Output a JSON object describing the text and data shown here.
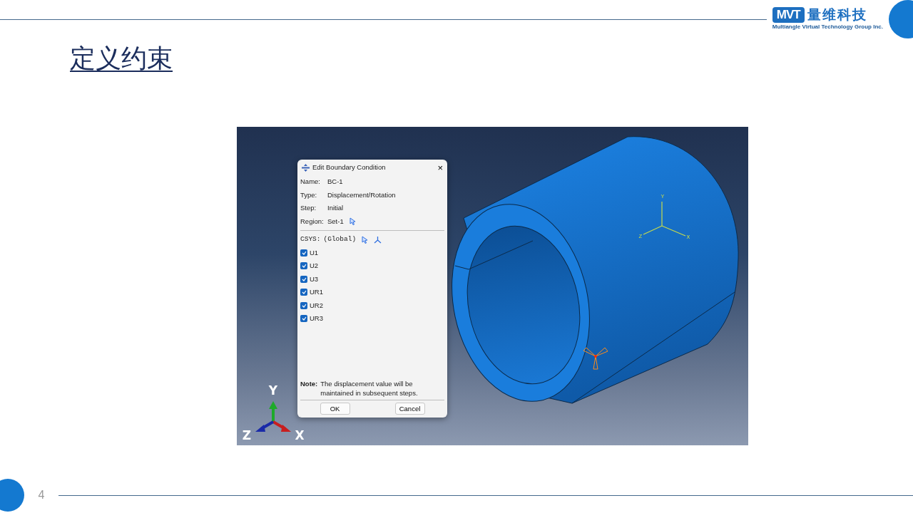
{
  "header": {
    "logo_mark": "MVT",
    "logo_name": "量维科技",
    "logo_tagline": "Multiangle Virtual Technology Group Inc."
  },
  "title": "定义约束",
  "viewport": {
    "dialog": {
      "title": "Edit Boundary Condition",
      "close": "×",
      "fields": [
        {
          "label": "Name:",
          "value": "BC-1",
          "kind": "text"
        },
        {
          "label": "Type:",
          "value": "Displacement/Rotation",
          "kind": "text"
        },
        {
          "label": "Step:",
          "value": "Initial",
          "kind": "text"
        },
        {
          "label": "Region:",
          "value": "Set-1",
          "kind": "picker"
        }
      ],
      "csys": {
        "label": "CSYS:",
        "value": "(Global)"
      },
      "dofs": [
        {
          "label": "U1",
          "checked": true
        },
        {
          "label": "U2",
          "checked": true
        },
        {
          "label": "U3",
          "checked": true
        },
        {
          "label": "UR1",
          "checked": true
        },
        {
          "label": "UR2",
          "checked": true
        },
        {
          "label": "UR3",
          "checked": true
        }
      ],
      "note": {
        "label": "Note:",
        "text": "The displacement value will be maintained in subsequent steps."
      },
      "buttons": [
        "OK",
        "Cancel"
      ]
    },
    "model_triad": {
      "y": "Y",
      "z": "Z",
      "x": "X"
    },
    "view_triad": {
      "y": "Y",
      "z": "Z",
      "x": "X"
    }
  },
  "page_number": "4"
}
